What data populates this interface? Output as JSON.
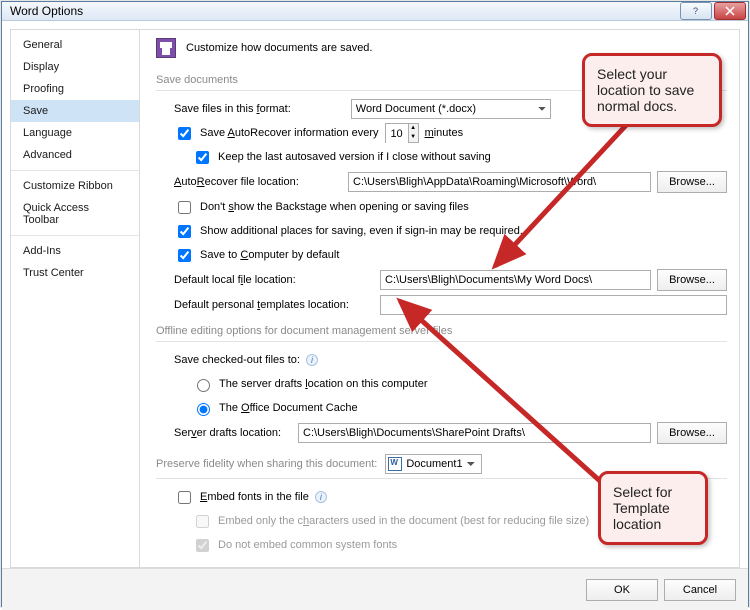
{
  "window": {
    "title": "Word Options"
  },
  "sidebar": {
    "items": [
      {
        "label": "General"
      },
      {
        "label": "Display"
      },
      {
        "label": "Proofing"
      },
      {
        "label": "Save",
        "selected": true
      },
      {
        "label": "Language"
      },
      {
        "label": "Advanced"
      },
      {
        "label": "Customize Ribbon"
      },
      {
        "label": "Quick Access Toolbar"
      },
      {
        "label": "Add-Ins"
      },
      {
        "label": "Trust Center"
      }
    ]
  },
  "header": {
    "text": "Customize how documents are saved."
  },
  "sections": {
    "save_documents": "Save documents",
    "offline": "Offline editing options for document management server files",
    "fidelity": "Preserve fidelity when sharing this document:"
  },
  "save": {
    "format_label_pre": "Save files in this ",
    "format_label_und": "f",
    "format_label_post": "ormat:",
    "format_value": "Word Document (*.docx)",
    "autorecover_pre": "Save ",
    "autorecover_und": "A",
    "autorecover_mid": "utoRecover information every",
    "autorecover_value": "10",
    "autorecover_unit": "minutes",
    "keep_last": "Keep the last autosaved version if I close without saving",
    "ar_loc_label_pre": "AutoRecover file location:",
    "ar_loc_value": "C:\\Users\\Bligh\\AppData\\Roaming\\Microsoft\\Word\\",
    "dont_show_pre": "Don't ",
    "dont_show_und": "s",
    "dont_show_post": "how the Backstage when opening or saving files",
    "show_places_pre": "Show additional places for saving, even if si",
    "show_places_und": "g",
    "show_places_post": "n-in may be required.",
    "save_computer_pre": "Save to ",
    "save_computer_und": "C",
    "save_computer_post": "omputer by default",
    "default_local_pre": "Default local f",
    "default_local_und": "i",
    "default_local_post": "le location:",
    "default_local_value": "C:\\Users\\Bligh\\Documents\\My Word Docs\\",
    "default_tpl_pre": "Default personal ",
    "default_tpl_und": "t",
    "default_tpl_post": "emplates location:",
    "default_tpl_value": ""
  },
  "offline": {
    "checked_out_label": "Save checked-out files to:",
    "radio_server_pre": "The server drafts ",
    "radio_server_und": "l",
    "radio_server_post": "ocation on this computer",
    "radio_cache_pre": "The ",
    "radio_cache_und": "O",
    "radio_cache_post": "ffice Document Cache",
    "server_drafts_label_pre": "Ser",
    "server_drafts_label_und": "v",
    "server_drafts_label_post": "er drafts location:",
    "server_drafts_value": "C:\\Users\\Bligh\\Documents\\SharePoint Drafts\\"
  },
  "fidelity": {
    "doc_value": "Document1",
    "embed_fonts_pre": "Embed fonts in the file",
    "embed_only_pre": "Embed only the c",
    "embed_only_und": "h",
    "embed_only_post": "aracters used in the document (best for reducing file size)",
    "do_not_embed": "Do not embed common system fonts"
  },
  "buttons": {
    "browse": "Browse...",
    "ok": "OK",
    "cancel": "Cancel"
  },
  "callouts": {
    "top": "Select your location to save normal docs.",
    "bottom": "Select for Template location"
  }
}
